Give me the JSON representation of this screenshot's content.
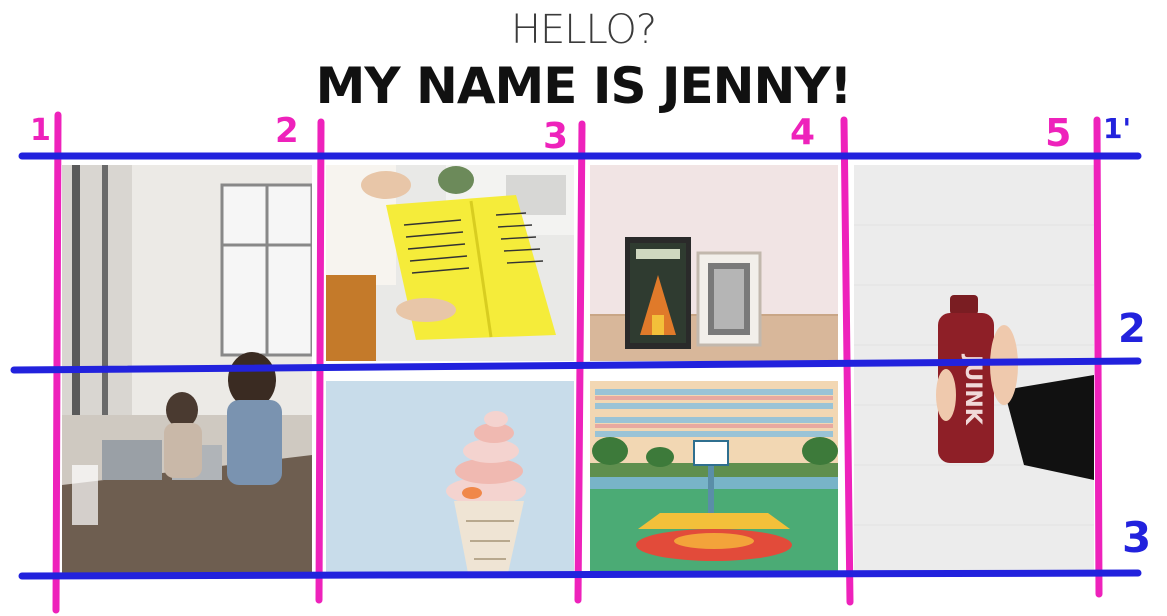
{
  "heading": {
    "line1": "HELLO?",
    "line2": "MY NAME IS JENNY!"
  },
  "grid_lines": {
    "column_line_color": "#ee22bb",
    "row_line_color": "#2222dd",
    "column_labels": [
      "1",
      "2",
      "3",
      "4",
      "5",
      "1'"
    ],
    "row_labels": [
      "2",
      "3"
    ]
  },
  "photos": [
    {
      "subject": "cafe-laptop-photo",
      "grid_area": "col 1-2, row 1-3"
    },
    {
      "subject": "yellow-magazine-photo",
      "grid_area": "col 2-3, row 1-2"
    },
    {
      "subject": "framed-posters-photo",
      "grid_area": "col 3-4, row 1-2"
    },
    {
      "subject": "juice-bottle-photo",
      "grid_area": "col 4-5, row 1-3"
    },
    {
      "subject": "ice-cream-sign-photo",
      "grid_area": "col 2-3, row 2-3"
    },
    {
      "subject": "basketball-court-photo",
      "grid_area": "col 3-4, row 2-3"
    }
  ],
  "juice_label": "JUINK"
}
